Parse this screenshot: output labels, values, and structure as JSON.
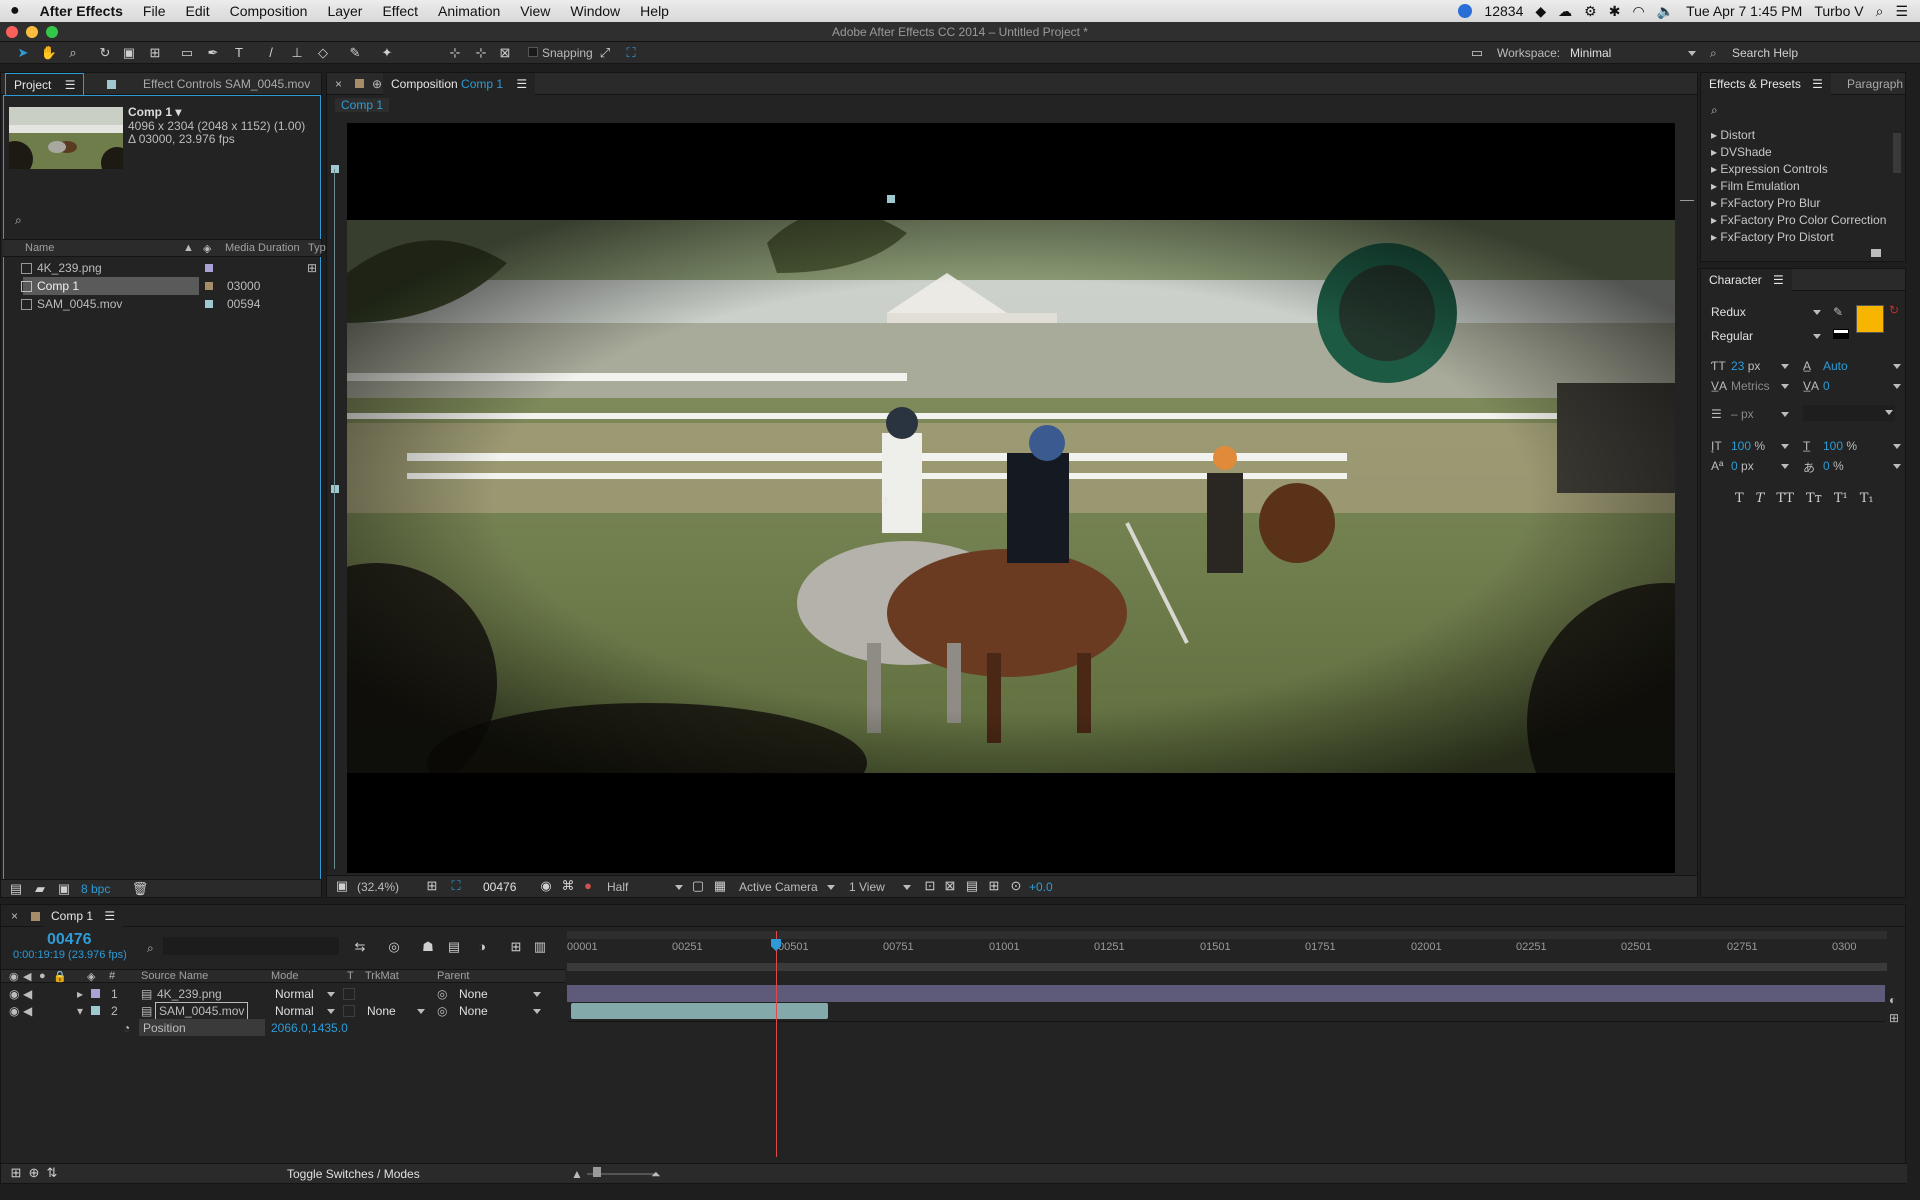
{
  "menubar": {
    "app": "After Effects",
    "items": [
      "File",
      "Edit",
      "Composition",
      "Layer",
      "Effect",
      "Animation",
      "View",
      "Window",
      "Help"
    ],
    "status_count": "12834",
    "clock": "Tue Apr 7  1:45 PM",
    "user": "Turbo V"
  },
  "window": {
    "title": "Adobe After Effects CC 2014 – Untitled Project *"
  },
  "toolbar": {
    "snapping": "Snapping",
    "workspace_label": "Workspace:",
    "workspace_value": "Minimal",
    "search_help": "Search Help"
  },
  "project": {
    "tab": "Project",
    "tab2": "Effect Controls SAM_0045.mov",
    "comp_name": "Comp 1 ▾",
    "comp_dims": "4096 x 2304  (2048 x 1152) (1.00)",
    "comp_dur": "Δ 03000, 23.976 fps",
    "col_name": "Name",
    "col_duration": "Media Duration",
    "col_type": "Typ",
    "items": [
      {
        "name": "4K_239.png",
        "duration": "",
        "color": "#a8a2d6"
      },
      {
        "name": "Comp 1",
        "duration": "03000",
        "color": "#a58d6a"
      },
      {
        "name": "SAM_0045.mov",
        "duration": "00594",
        "color": "#9ec9cf"
      }
    ],
    "bpc": "8 bpc"
  },
  "composition": {
    "header_label": "Composition",
    "header_name": "Comp 1",
    "tab": "Comp 1",
    "zoom": "(32.4%)",
    "timecode": "00476",
    "resolution": "Half",
    "camera": "Active Camera",
    "views": "1 View",
    "exposure": "+0.0"
  },
  "effects_presets": {
    "tab": "Effects & Presets",
    "tab2": "Paragraph",
    "items": [
      "Distort",
      "DVShade",
      "Expression Controls",
      "Film Emulation",
      "FxFactory Pro Blur",
      "FxFactory Pro Color Correction",
      "FxFactory Pro Distort"
    ]
  },
  "character": {
    "tab": "Character",
    "font": "Redux",
    "style": "Regular",
    "size": "23",
    "size_unit": "px",
    "leading": "Auto",
    "kerning": "Metrics",
    "tracking": "0",
    "stroke": "– px",
    "vscale": "100",
    "hscale": "100",
    "pct": "%",
    "baseline": "0",
    "baseline_unit": "px",
    "tsume": "0",
    "fill_color": "#f7b500",
    "style_buttons": [
      "T",
      "T",
      "TT",
      "Tт",
      "T¹",
      "T₁"
    ]
  },
  "timeline": {
    "tab": "Comp 1",
    "timecode": "00476",
    "time_sub": "0:00:19:19 (23.976 fps)",
    "col_source": "Source Name",
    "col_mode": "Mode",
    "col_t": "T",
    "col_trkmat": "TrkMat",
    "col_parent": "Parent",
    "ruler": [
      "00001",
      "00251",
      "00501",
      "00751",
      "01001",
      "01251",
      "01501",
      "01751",
      "02001",
      "02251",
      "02501",
      "02751",
      "0300"
    ],
    "layers": [
      {
        "num": "1",
        "name": "4K_239.png",
        "mode": "Normal",
        "trkmat": "",
        "parent": "None",
        "color": "#a8a2d6"
      },
      {
        "num": "2",
        "name": "SAM_0045.mov",
        "mode": "Normal",
        "trkmat": "None",
        "parent": "None",
        "color": "#9ec9cf"
      }
    ],
    "property_name": "Position",
    "property_value": "2066.0,1435.0",
    "toggle_label": "Toggle Switches / Modes",
    "playhead_frame": 476,
    "total_frames": 3000
  }
}
